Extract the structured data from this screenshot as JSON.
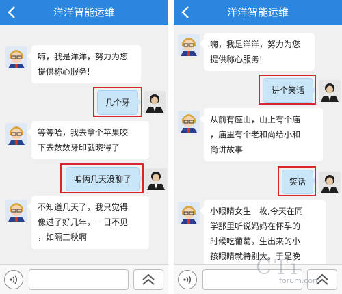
{
  "left": {
    "title": "洋洋智能运维",
    "messages": [
      {
        "lines": [
          "嗨，我是洋洋，努力为您",
          "提供称心服务!"
        ]
      },
      {
        "lines": [
          "几个牙"
        ]
      },
      {
        "lines": [
          "等等哈，我去拿个苹果咬",
          "下去数数牙印就晓得了"
        ]
      },
      {
        "lines": [
          "咱俩几天没聊了"
        ]
      },
      {
        "lines": [
          "不知道几天了，我只觉得",
          "像过了好几年，一日不见",
          "，如隔三秋啊"
        ]
      }
    ]
  },
  "right": {
    "title": "洋洋智能运维",
    "messages": [
      {
        "lines": [
          "嗨，我是洋洋，努力为您",
          "提供称心服务!"
        ]
      },
      {
        "lines": [
          "讲个笑话"
        ]
      },
      {
        "lines": [
          "从前有座山，山上有个庙",
          "，庙里有个老和尚给小和",
          "尚讲故事"
        ]
      },
      {
        "lines": [
          "笑话"
        ]
      },
      {
        "lines": [
          "小眼睛女生一枚,今天在同",
          "学那里听说妈妈在怀孕的",
          "时候吃葡萄，生出来的小",
          "孩眼睛就特别大。于是晚"
        ]
      }
    ]
  },
  "watermark": {
    "big": "CTi",
    "small": "forum.com"
  },
  "colors": {
    "header": "#2a86df",
    "user_bubble": "#c9e6f9",
    "highlight": "#d9262c"
  },
  "icons": {
    "back": "chevron-left-icon",
    "voice": "voice-icon",
    "expand": "double-chevron-up-icon"
  }
}
